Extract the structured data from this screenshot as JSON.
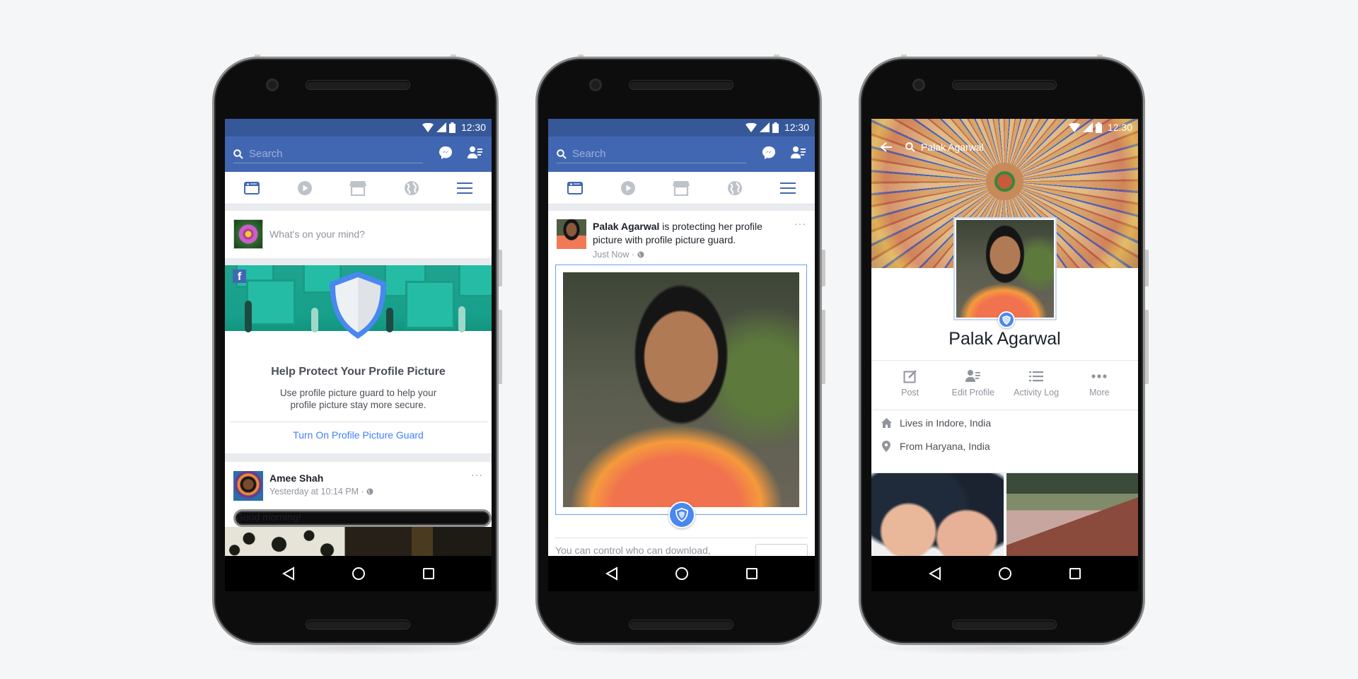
{
  "status_bar": {
    "time": "12:30"
  },
  "phones": [
    {
      "header": {
        "search_placeholder": "Search"
      },
      "composer": {
        "placeholder": "What's on your mind?"
      },
      "promo_card": {
        "brand": "f",
        "title": "Help Protect Your Profile Picture",
        "body": "Use profile picture guard to help your profile picture stay more secure.",
        "cta": "Turn On Profile Picture Guard"
      },
      "post": {
        "author": "Amee Shah",
        "timestamp": "Yesterday at 10:14 PM",
        "privacy_separator": "·",
        "more": "···",
        "text": "Good morning!"
      }
    },
    {
      "header": {
        "search_placeholder": "Search"
      },
      "post": {
        "author": "Palak Agarwal",
        "headline_rest": " is protecting her profile picture with profile picture guard.",
        "timestamp": "Just Now",
        "privacy_separator": "·",
        "more": "···",
        "footer_text": "You can control who can download,"
      }
    },
    {
      "header": {
        "search_text": "Palak Agarwal"
      },
      "profile": {
        "name": "Palak Agarwal",
        "actions": [
          {
            "label": "Post",
            "icon": "edit-icon"
          },
          {
            "label": "Edit Profile",
            "icon": "edit-profile-icon"
          },
          {
            "label": "Activity Log",
            "icon": "list-icon"
          },
          {
            "label": "More",
            "icon": "more-icon"
          }
        ],
        "about": [
          {
            "icon": "home-icon",
            "text": "Lives in Indore, India"
          },
          {
            "icon": "location-pin-icon",
            "text": "From Haryana, India"
          }
        ]
      }
    }
  ],
  "colors": {
    "facebook_blue": "#4267b2",
    "status_blue": "#365899",
    "link_blue": "#4080ff",
    "guard_blue": "#4a88f0",
    "background": "#f5f6f8"
  }
}
